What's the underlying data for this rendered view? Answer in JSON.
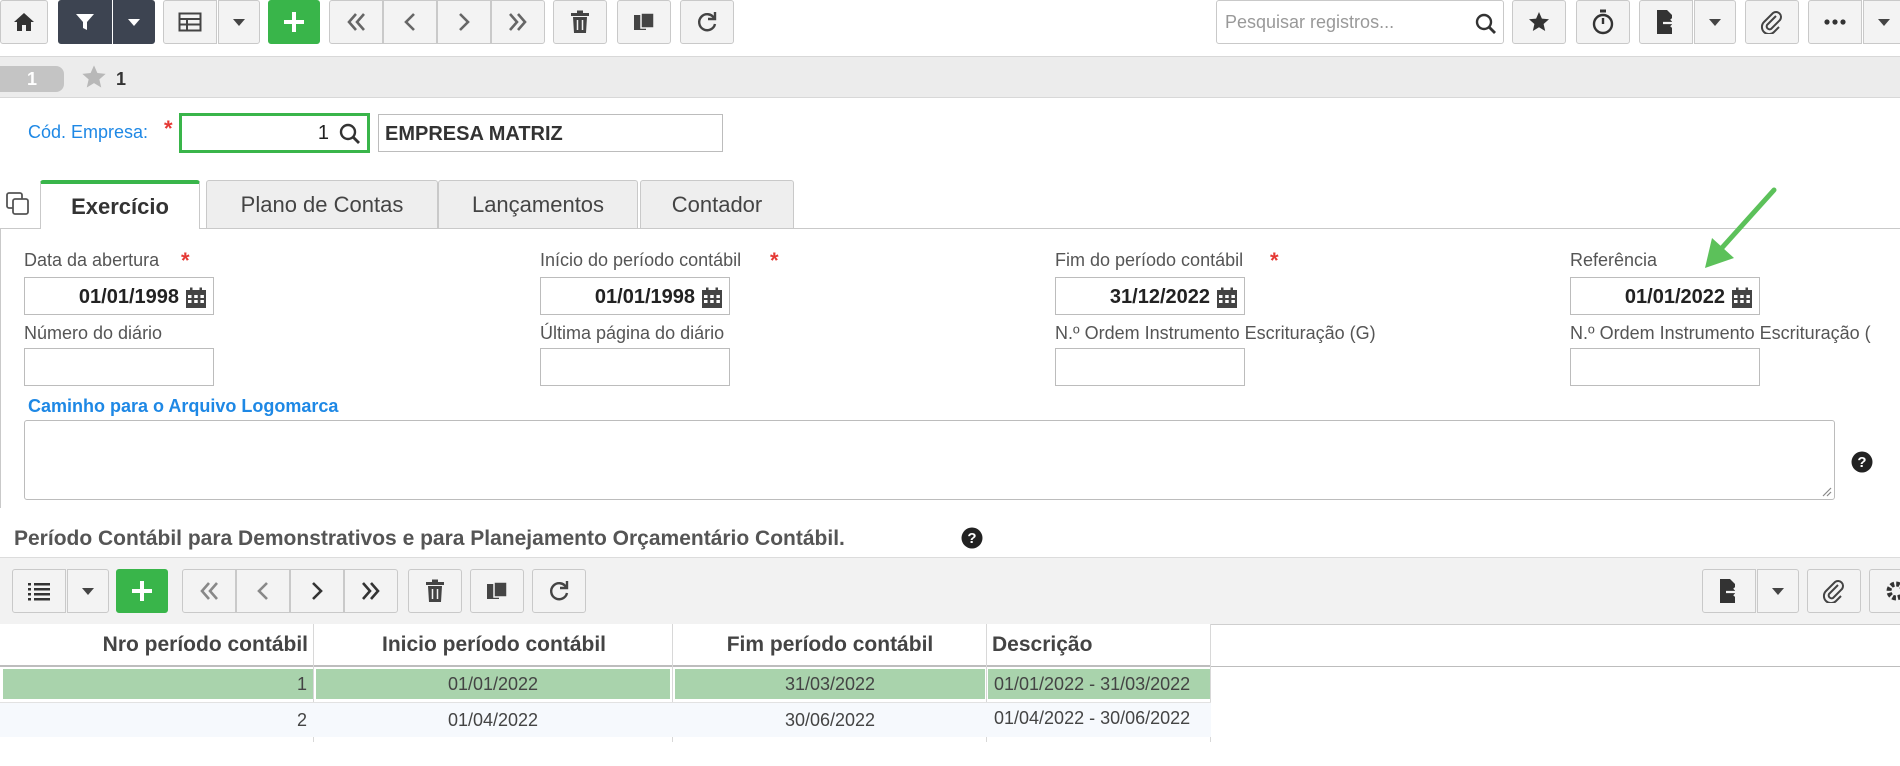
{
  "toolbar": {
    "search_placeholder": "Pesquisar registros...",
    "icons": [
      "home-icon",
      "filter-icon",
      "caret-down-icon",
      "grid-icon",
      "caret-down-icon",
      "plus-icon",
      "first-icon",
      "prev-icon",
      "next-icon",
      "last-icon",
      "trash-icon",
      "copy-icon",
      "refresh-icon",
      "search-icon",
      "star-icon",
      "timer-icon",
      "export-icon",
      "caret-down-icon",
      "paperclip-icon",
      "more-icon",
      "caret-down-icon"
    ]
  },
  "record_strip": {
    "page": "1",
    "favorite_count": "1"
  },
  "company": {
    "label": "Cód. Empresa:",
    "code": "1",
    "name": "EMPRESA MATRIZ"
  },
  "tabs": [
    {
      "label": "Exercício",
      "active": true
    },
    {
      "label": "Plano de Contas"
    },
    {
      "label": "Lançamentos"
    },
    {
      "label": "Contador"
    }
  ],
  "form": {
    "data_abertura": {
      "label": "Data da abertura",
      "value": "01/01/1998"
    },
    "inicio_periodo": {
      "label": "Início do período contábil",
      "value": "01/01/1998"
    },
    "fim_periodo": {
      "label": "Fim do período contábil",
      "value": "31/12/2022"
    },
    "referencia": {
      "label": "Referência",
      "value": "01/01/2022"
    },
    "numero_diario": {
      "label": "Número do diário",
      "value": ""
    },
    "ultima_pagina": {
      "label": "Última página do diário",
      "value": ""
    },
    "ordem_g": {
      "label": "N.º Ordem Instrumento Escrituração (G)",
      "value": ""
    },
    "ordem_r": {
      "label": "N.º Ordem Instrumento Escrituração (",
      "value": ""
    },
    "logomarca": {
      "label": "Caminho para o Arquivo Logomarca",
      "value": ""
    }
  },
  "section": {
    "title": "Período Contábil para Demonstrativos e para Planejamento Orçamentário Contábil."
  },
  "grid": {
    "headers": [
      "Nro período contábil",
      "Inicio período contábil",
      "Fim período contábil",
      "Descrição"
    ],
    "rows": [
      [
        "1",
        "01/01/2022",
        "31/03/2022",
        "01/01/2022 - 31/03/2022"
      ],
      [
        "2",
        "01/04/2022",
        "30/06/2022",
        "01/04/2022 - 30/06/2022"
      ]
    ]
  },
  "colors": {
    "accent_green": "#39b54a",
    "selected_row": "#a9d3ac",
    "link_blue": "#1e88e5",
    "required_red": "#e53935",
    "arrow_green": "#5cc15a"
  }
}
